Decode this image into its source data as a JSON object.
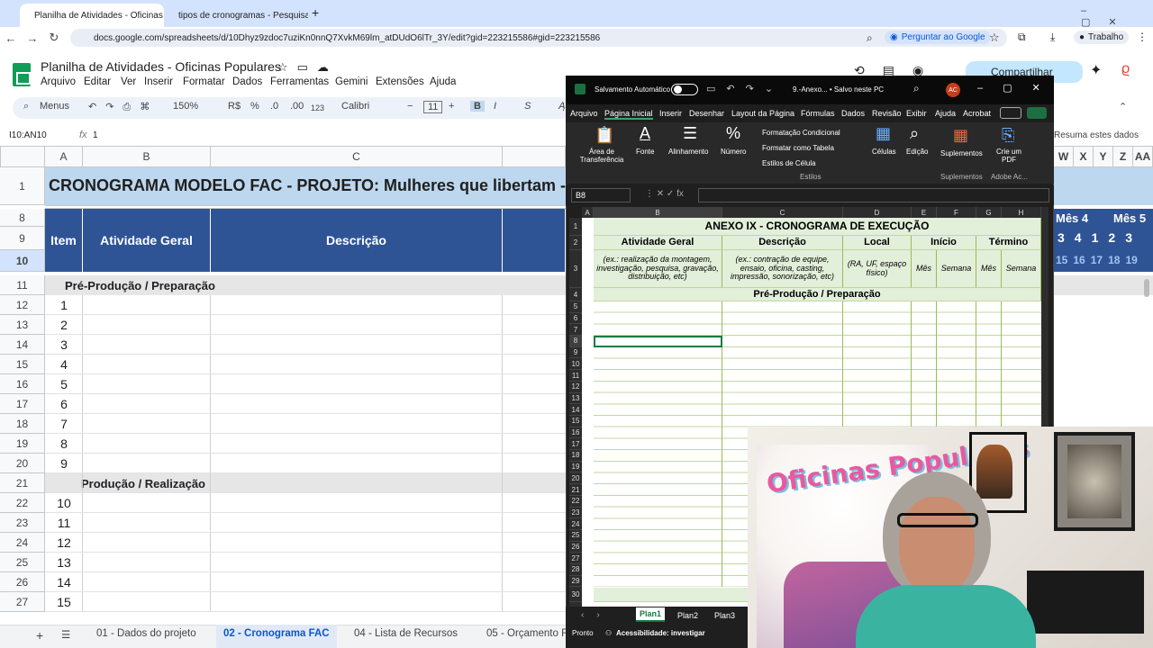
{
  "browser": {
    "tabs": [
      {
        "label": "Planilha de Atividades - Oficinas",
        "active": true
      },
      {
        "label": "tipos de cronogramas - Pesquisa",
        "active": false
      }
    ],
    "url": "docs.google.com/spreadsheets/d/10Dhyz9zdoc7uziKn0nnQ7XvkM69lm_atDUdO6lTr_3Y/edit?gid=223215586#gid=223215586",
    "translate_label": "Perguntar ao Google",
    "profile_label": "Trabalho"
  },
  "sheets": {
    "title": "Planilha de Atividades - Oficinas Populares",
    "menu": [
      "Arquivo",
      "Editar",
      "Ver",
      "Inserir",
      "Formatar",
      "Dados",
      "Ferramentas",
      "Gemini",
      "Extensões",
      "Ajuda"
    ],
    "share_label": "Compartilhar",
    "toolbar": {
      "search": "Menus",
      "zoom": "150%",
      "currency": "R$",
      "percent": "%",
      "dec_dec": ".0",
      "dec_inc": ".00",
      "fmt": "123",
      "font": "Calibri",
      "size": "11"
    },
    "name_box": "I10:AN10",
    "formula": "1",
    "summarize": "Resuma estes dados",
    "columns": [
      "A",
      "B",
      "C"
    ],
    "right_cols": [
      "W",
      "X",
      "Y",
      "Z",
      "AA"
    ],
    "title_row": "CRONOGRAMA MODELO FAC - PROJETO: Mulheres que libertam - P",
    "header": {
      "item": "Item",
      "activity": "Atividade Geral",
      "desc": "Descrição"
    },
    "month_labels": [
      "Mês 4",
      "Mês 5"
    ],
    "week_nums": [
      "3",
      "4",
      "1",
      "2",
      "3"
    ],
    "day_nums": [
      "15",
      "16",
      "17",
      "18",
      "19"
    ],
    "row_numbers": [
      "1",
      "8",
      "9",
      "10",
      "11",
      "12",
      "13",
      "14",
      "15",
      "16",
      "17",
      "18",
      "19",
      "20",
      "21",
      "22",
      "23",
      "24",
      "25",
      "26",
      "27"
    ],
    "section1": "Pré-Produção / Preparação",
    "section2": "Produção / Realização",
    "items_a": [
      "1",
      "2",
      "3",
      "4",
      "5",
      "6",
      "7",
      "8",
      "9"
    ],
    "items_b": [
      "10",
      "11",
      "12",
      "13",
      "14",
      "15"
    ],
    "sheet_tabs": [
      "01 - Dados do projeto",
      "02 - Cronograma FAC",
      "04 - Lista de Recursos",
      "05 - Orçamento F"
    ]
  },
  "excel": {
    "autosave": "Salvamento Automático",
    "file": "9.-Anexo... • Salvo neste PC",
    "avatar": "AC",
    "ribbon_tabs": [
      "Arquivo",
      "Página Inicial",
      "Inserir",
      "Desenhar",
      "Layout da Página",
      "Fórmulas",
      "Dados",
      "Revisão",
      "Exibir",
      "Ajuda",
      "Acrobat"
    ],
    "ribbon": {
      "clipboard": "Área de Transferência",
      "font": "Fonte",
      "align": "Alinhamento",
      "number": "Número",
      "cond": "Formatação Condicional",
      "table": "Formatar como Tabela",
      "cellstyle": "Estilos de Célula",
      "styles": "Estilos",
      "cells": "Células",
      "edit": "Edição",
      "addins": "Suplementos",
      "addins_grp": "Suplementos",
      "pdf": "Crie um PDF",
      "adobe": "Adobe Ac..."
    },
    "cell_ref": "B8",
    "cols": [
      "A",
      "B",
      "C",
      "D",
      "E",
      "F",
      "G",
      "H"
    ],
    "title": "ANEXO IX - CRONOGRAMA DE EXECUÇÃO",
    "h_activity": "Atividade Geral",
    "h_desc": "Descrição",
    "h_local": "Local",
    "h_start": "Início",
    "h_end": "Término",
    "ex_activity": "(ex.: realização da montagem, investigação, pesquisa, gravação, distribuição, etc)",
    "ex_desc": "(ex.: contração de equipe, ensaio, oficina, casting, impressão, sonorização, etc)",
    "ex_local": "(RA, UF, espaço físico)",
    "mes": "Mês",
    "semana": "Semana",
    "section": "Pré-Produção / Preparação",
    "rows": [
      "1",
      "2",
      "3",
      "4",
      "5",
      "6",
      "7",
      "8",
      "9",
      "10",
      "11",
      "12",
      "13",
      "14",
      "15",
      "16",
      "17",
      "18",
      "19",
      "20",
      "21",
      "22",
      "23",
      "24",
      "25",
      "26",
      "27",
      "28",
      "29",
      "30"
    ],
    "sheets": [
      "Plan1",
      "Plan2",
      "Plan3"
    ],
    "status_ready": "Pronto",
    "status_access": "Acessibilidade: investigar"
  },
  "webcam": {
    "logo_text": "Oficinas Populares"
  }
}
